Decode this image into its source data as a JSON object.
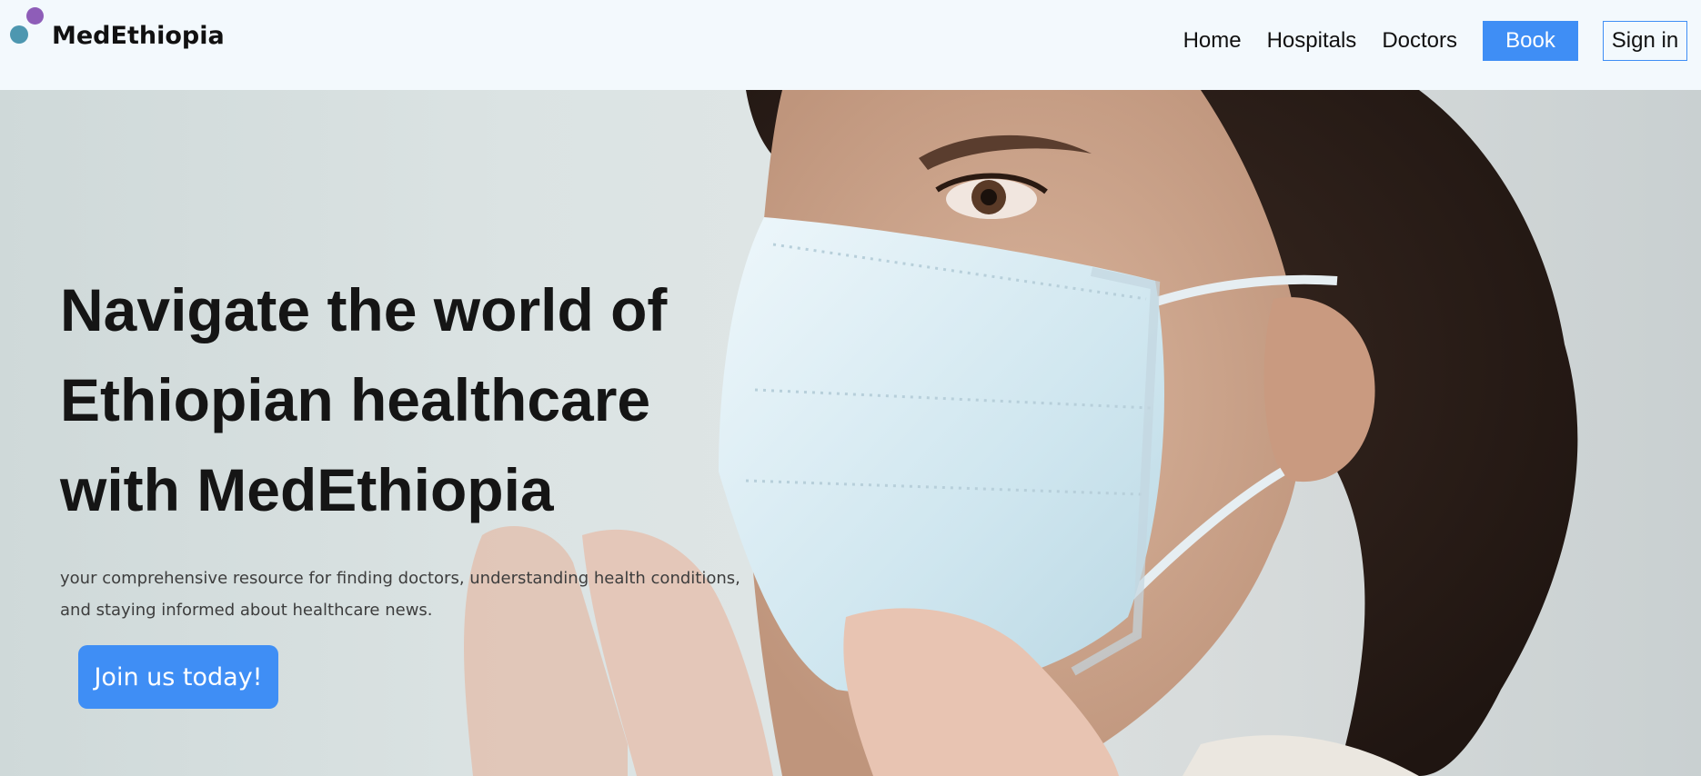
{
  "brand": {
    "name": "MedEthiopia",
    "colors": {
      "teal": "#4d97b0",
      "purple": "#8e5db8",
      "accent": "#3f8ef5"
    }
  },
  "nav": {
    "links": [
      "Home",
      "Hospitals",
      "Doctors"
    ],
    "book_label": "Book",
    "signin_label": "Sign in"
  },
  "hero": {
    "title_lines": [
      "Navigate the world of",
      "Ethiopian healthcare",
      "with MedEthiopia"
    ],
    "subtitle_lines": [
      "your comprehensive resource for finding doctors, understanding health conditions,",
      "and staying informed about healthcare news."
    ],
    "cta_label": "Join us today!",
    "image": "woman-wearing-surgical-mask-photo"
  }
}
